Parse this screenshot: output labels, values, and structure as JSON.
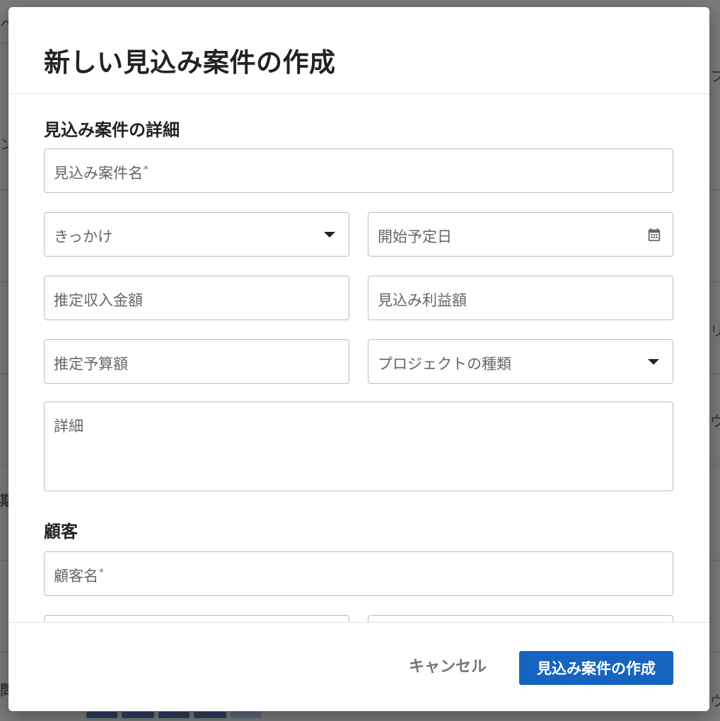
{
  "background": {
    "fragments": [
      "ベ",
      "フ",
      "ン",
      "リ",
      "ウ",
      "期",
      "問",
      "ウ"
    ]
  },
  "dialog": {
    "title": "新しい見込み案件の作成",
    "sections": {
      "details": {
        "title": "見込み案件の詳細",
        "name_field": {
          "placeholder": "見込み案件名",
          "required_mark": "*"
        },
        "trigger_select": {
          "placeholder": "きっかけ"
        },
        "start_date": {
          "placeholder": "開始予定日"
        },
        "estimated_revenue": {
          "placeholder": "推定収入金額"
        },
        "expected_profit": {
          "placeholder": "見込み利益額"
        },
        "estimated_budget": {
          "placeholder": "推定予算額"
        },
        "project_type_select": {
          "placeholder": "プロジェクトの種類"
        },
        "description": {
          "placeholder": "詳細"
        }
      },
      "customer": {
        "title": "顧客",
        "name_field": {
          "placeholder": "顧客名",
          "required_mark": "*"
        }
      }
    },
    "footer": {
      "cancel_label": "キャンセル",
      "create_label": "見込み案件の作成"
    }
  },
  "colors": {
    "primary": "#1565c0",
    "overlay": "#7c7c7c"
  }
}
